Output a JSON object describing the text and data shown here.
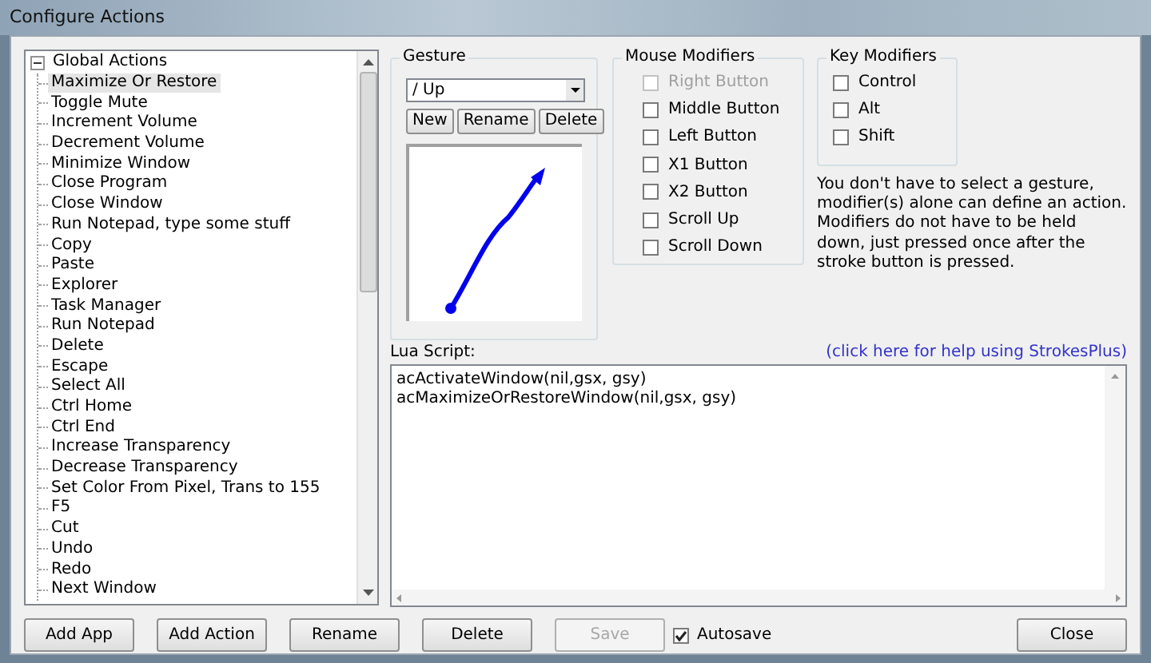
{
  "window": {
    "title": "Configure Actions"
  },
  "tree": {
    "label": "Global Actions",
    "expanded": true,
    "children": [
      {
        "label": "Maximize Or Restore",
        "selected": true
      },
      {
        "label": "Toggle Mute",
        "selected": false
      },
      {
        "label": "Increment Volume",
        "selected": false
      },
      {
        "label": "Decrement Volume",
        "selected": false
      },
      {
        "label": "Minimize Window",
        "selected": false
      },
      {
        "label": "Close Program",
        "selected": false
      },
      {
        "label": "Close Window",
        "selected": false
      },
      {
        "label": "Run Notepad, type some stuff",
        "selected": false
      },
      {
        "label": "Copy",
        "selected": false
      },
      {
        "label": "Paste",
        "selected": false
      },
      {
        "label": "Explorer",
        "selected": false
      },
      {
        "label": "Task Manager",
        "selected": false
      },
      {
        "label": "Run Notepad",
        "selected": false
      },
      {
        "label": "Delete",
        "selected": false
      },
      {
        "label": "Escape",
        "selected": false
      },
      {
        "label": "Select All",
        "selected": false
      },
      {
        "label": "Ctrl Home",
        "selected": false
      },
      {
        "label": "Ctrl End",
        "selected": false
      },
      {
        "label": "Increase Transparency",
        "selected": false
      },
      {
        "label": "Decrease Transparency",
        "selected": false
      },
      {
        "label": "Set Color From Pixel, Trans to 155",
        "selected": false
      },
      {
        "label": "F5",
        "selected": false
      },
      {
        "label": "Cut",
        "selected": false
      },
      {
        "label": "Undo",
        "selected": false
      },
      {
        "label": "Redo",
        "selected": false
      },
      {
        "label": "Next Window",
        "selected": false
      }
    ]
  },
  "gesture": {
    "title": "Gesture",
    "selected_gesture": "/ Up",
    "buttons": [
      "New",
      "Rename",
      "Delete"
    ]
  },
  "mouse_modifiers": {
    "title": "Mouse Modifiers",
    "items": [
      {
        "label": "Right Button",
        "checked": false,
        "disabled": true
      },
      {
        "label": "Middle Button",
        "checked": false,
        "disabled": false
      },
      {
        "label": "Left Button",
        "checked": false,
        "disabled": false
      },
      {
        "label": "X1 Button",
        "checked": false,
        "disabled": false
      },
      {
        "label": "X2 Button",
        "checked": false,
        "disabled": false
      },
      {
        "label": "Scroll Up",
        "checked": false,
        "disabled": false
      },
      {
        "label": "Scroll Down",
        "checked": false,
        "disabled": false
      }
    ]
  },
  "key_modifiers": {
    "title": "Key Modifiers",
    "items": [
      {
        "label": "Control",
        "checked": false
      },
      {
        "label": "Alt",
        "checked": false
      },
      {
        "label": "Shift",
        "checked": false
      }
    ]
  },
  "help_text": "You don't have to select a gesture, modifier(s) alone can define an action. Modifiers do not have to be held down, just pressed once after the stroke button is pressed.",
  "lua_script": {
    "label": "Lua Script:",
    "help_link": "(click here for help using StrokesPlus)",
    "lines": [
      "acActivateWindow(nil,gsx, gsy)",
      "acMaximizeOrRestoreWindow(nil,gsx, gsy)"
    ]
  },
  "bottom_bar": {
    "buttons": [
      {
        "label": "Add App",
        "disabled": false
      },
      {
        "label": "Add Action",
        "disabled": false
      },
      {
        "label": "Rename",
        "disabled": false
      },
      {
        "label": "Delete",
        "disabled": false
      },
      {
        "label": "Save",
        "disabled": true
      }
    ],
    "autosave": {
      "label": "Autosave",
      "checked": true
    },
    "close": "Close"
  }
}
